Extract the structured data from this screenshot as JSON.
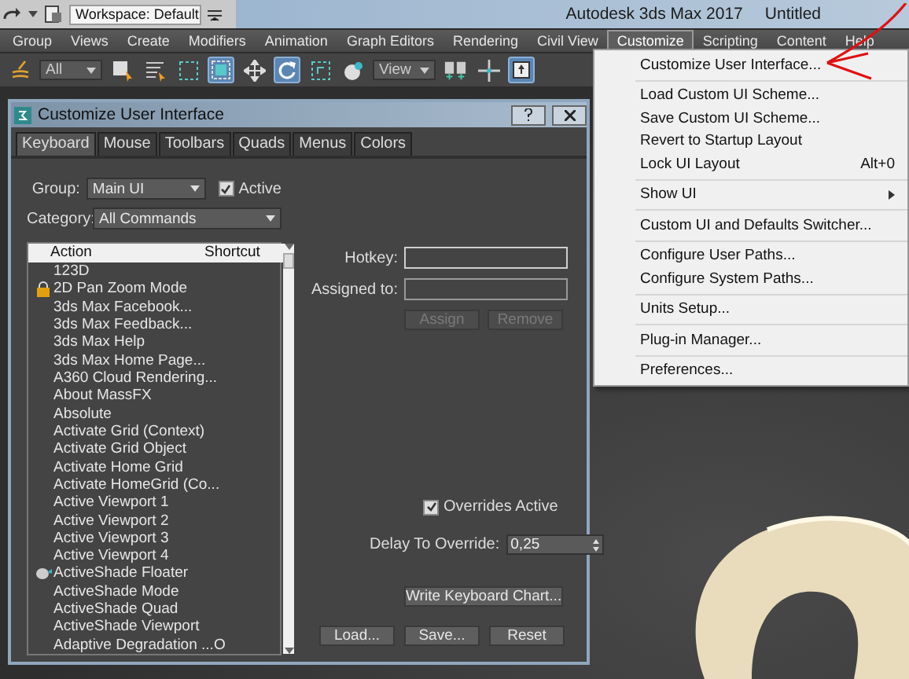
{
  "title_bar": {
    "workspace": "Workspace: Default",
    "app_title": "Autodesk 3ds Max 2017",
    "document": "Untitled"
  },
  "menu_bar": [
    {
      "label": "Group",
      "selected": false
    },
    {
      "label": "Views",
      "selected": false
    },
    {
      "label": "Create",
      "selected": false
    },
    {
      "label": "Modifiers",
      "selected": false
    },
    {
      "label": "Animation",
      "selected": false
    },
    {
      "label": "Graph Editors",
      "selected": false
    },
    {
      "label": "Rendering",
      "selected": false
    },
    {
      "label": "Civil View",
      "selected": false
    },
    {
      "label": "Customize",
      "selected": true
    },
    {
      "label": "Scripting",
      "selected": false
    },
    {
      "label": "Content",
      "selected": false
    },
    {
      "label": "Help",
      "selected": false
    }
  ],
  "toolbar": [
    {
      "kind": "link",
      "selected": false
    },
    {
      "kind": "dropdown",
      "value": "All"
    },
    {
      "kind": "select",
      "selected": false
    },
    {
      "kind": "select-list",
      "selected": false
    },
    {
      "kind": "region",
      "selected": false
    },
    {
      "kind": "window",
      "selected": true
    },
    {
      "kind": "move",
      "selected": false
    },
    {
      "kind": "rotate",
      "selected": true
    },
    {
      "kind": "scale",
      "selected": false
    },
    {
      "kind": "place",
      "selected": false
    },
    {
      "kind": "dropdown",
      "value": "View"
    },
    {
      "kind": "pivot",
      "selected": false
    },
    {
      "kind": "manipulate",
      "selected": false
    },
    {
      "kind": "override",
      "selected": true
    }
  ],
  "dialog": {
    "title": "Customize User Interface",
    "tabs": [
      {
        "label": "Keyboard",
        "selected": true
      },
      {
        "label": "Mouse",
        "selected": false
      },
      {
        "label": "Toolbars",
        "selected": false
      },
      {
        "label": "Quads",
        "selected": false
      },
      {
        "label": "Menus",
        "selected": false
      },
      {
        "label": "Colors",
        "selected": false
      }
    ],
    "group_label": "Group:",
    "group_value": "Main UI",
    "active": {
      "label": "Active",
      "checked": true
    },
    "category_label": "Category:",
    "category_value": "All Commands",
    "columns": [
      "Action",
      "Shortcut"
    ],
    "actions": [
      {
        "action": "123D",
        "kind": "plain"
      },
      {
        "action": "2D Pan Zoom Mode",
        "kind": "pan"
      },
      {
        "action": "3ds Max Facebook...",
        "kind": "plain"
      },
      {
        "action": "3ds Max Feedback...",
        "kind": "plain"
      },
      {
        "action": "3ds Max Help",
        "kind": "plain"
      },
      {
        "action": "3ds Max Home Page...",
        "kind": "plain"
      },
      {
        "action": "A360 Cloud Rendering...",
        "kind": "plain"
      },
      {
        "action": "About MassFX",
        "kind": "plain"
      },
      {
        "action": "Absolute",
        "kind": "plain"
      },
      {
        "action": "Activate Grid (Context)",
        "kind": "plain"
      },
      {
        "action": "Activate Grid Object",
        "kind": "plain"
      },
      {
        "action": "Activate Home Grid",
        "kind": "plain"
      },
      {
        "action": "Activate HomeGrid (Co...",
        "kind": "plain"
      },
      {
        "action": "Active Viewport 1",
        "kind": "plain"
      },
      {
        "action": "Active Viewport 2",
        "kind": "plain"
      },
      {
        "action": "Active Viewport 3",
        "kind": "plain"
      },
      {
        "action": "Active Viewport 4",
        "kind": "plain"
      },
      {
        "action": "ActiveShade Floater",
        "kind": "shade"
      },
      {
        "action": "ActiveShade Mode",
        "kind": "plain"
      },
      {
        "action": "ActiveShade Quad",
        "kind": "plain"
      },
      {
        "action": "ActiveShade Viewport",
        "kind": "plain"
      },
      {
        "action": "Adaptive Degradation ...",
        "kind": "plain",
        "shortcut": "O"
      }
    ],
    "hotkey_label": "Hotkey:",
    "assigned_label": "Assigned to:",
    "assign_button": "Assign",
    "remove_button": "Remove",
    "overrides": {
      "label": "Overrides Active",
      "checked": true
    },
    "delay_label": "Delay To Override:",
    "delay_value": "0,25",
    "write_chart_button": "Write Keyboard Chart...",
    "buttons": [
      "Load...",
      "Save...",
      "Reset"
    ]
  },
  "customize_menu": [
    [
      {
        "label": "Customize User Interface...",
        "has_submenu": false
      }
    ],
    [
      {
        "label": "Load Custom UI Scheme...",
        "has_submenu": false
      },
      {
        "label": "Save Custom UI Scheme...",
        "has_submenu": false
      },
      {
        "label": "Revert to Startup Layout",
        "has_submenu": false
      },
      {
        "label": "Lock UI Layout",
        "shortcut": "Alt+0",
        "has_submenu": false
      }
    ],
    [
      {
        "label": "Show UI",
        "has_submenu": true
      }
    ],
    [
      {
        "label": "Custom UI and Defaults Switcher...",
        "has_submenu": false
      }
    ],
    [
      {
        "label": "Configure User Paths...",
        "has_submenu": false
      },
      {
        "label": "Configure System Paths...",
        "has_submenu": false
      }
    ],
    [
      {
        "label": "Units Setup...",
        "has_submenu": false
      }
    ],
    [
      {
        "label": "Plug-in Manager...",
        "has_submenu": false
      }
    ],
    [
      {
        "label": "Preferences...",
        "has_submenu": false
      }
    ]
  ]
}
